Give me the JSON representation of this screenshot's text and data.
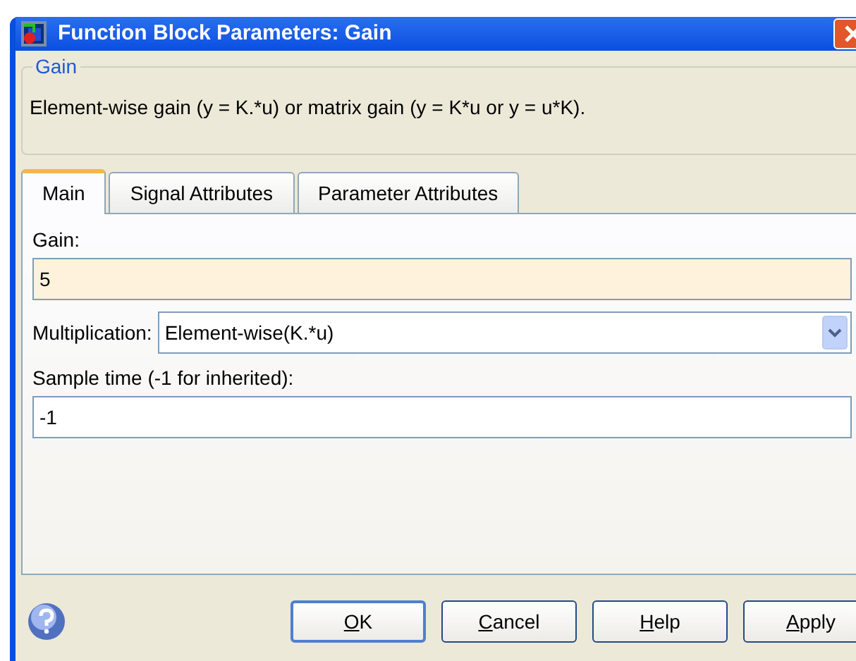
{
  "window": {
    "title": "Function Block Parameters: Gain"
  },
  "group": {
    "title": "Gain",
    "description": "Element-wise gain (y = K.*u) or matrix gain (y = K*u or y = u*K)."
  },
  "tabs": [
    {
      "label": "Main",
      "selected": true
    },
    {
      "label": "Signal Attributes",
      "selected": false
    },
    {
      "label": "Parameter Attributes",
      "selected": false
    }
  ],
  "fields": [
    {
      "kind": "text",
      "label": "Gain:",
      "value": "5",
      "highlighted": true
    },
    {
      "kind": "dropdown",
      "label": "Multiplication:",
      "value": "Element-wise(K.*u)"
    },
    {
      "kind": "text",
      "label": "Sample time (-1 for inherited):",
      "value": "-1",
      "highlighted": false
    }
  ],
  "buttons": [
    {
      "label": "OK",
      "first_letter_underlined": true,
      "default": true
    },
    {
      "label": "Cancel",
      "first_letter_underlined": true,
      "default": false
    },
    {
      "label": "Help",
      "first_letter_underlined": true,
      "default": false
    },
    {
      "label": "Apply",
      "first_letter_underlined": true,
      "default": false
    }
  ]
}
